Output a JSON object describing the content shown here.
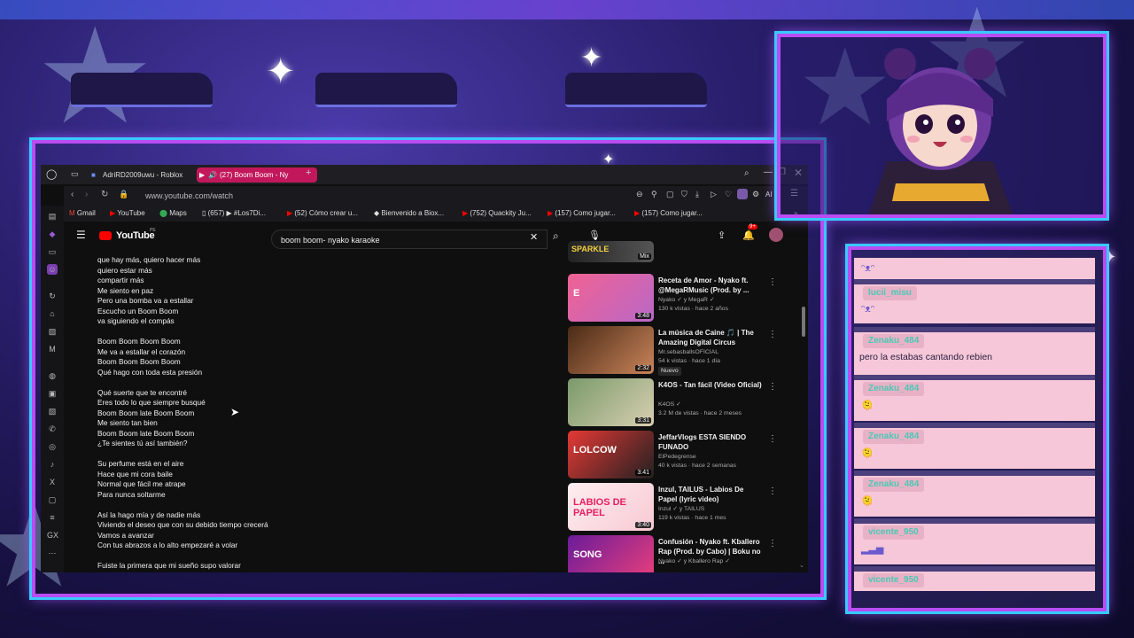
{
  "browser": {
    "tabs": [
      {
        "label": "AdriRD2009uwu - Roblox"
      },
      {
        "label": "(27) Boom Boom - Ny"
      }
    ],
    "new_tab": "+",
    "url": "www.youtube.com/watch",
    "ai_label": "AI",
    "bookmarks": [
      {
        "label": "Gmail"
      },
      {
        "label": "YouTube"
      },
      {
        "label": "Maps"
      },
      {
        "label": "(657) ▶ #Los7Di..."
      },
      {
        "label": "(52) Cómo crear u..."
      },
      {
        "label": "Bienvenido a Biox..."
      },
      {
        "label": "(752) Quackity Ju..."
      },
      {
        "label": "(157) Como jugar..."
      },
      {
        "label": "(157) Como jugar..."
      }
    ]
  },
  "youtube": {
    "logo": "YouTube",
    "logo_region": "PE",
    "search_value": "boom boom- nyako karaoke",
    "notif_count": "9+",
    "lyrics": [
      [
        "que hay más, quiero hacer más",
        "quiero estar más",
        "compartir más",
        "Me siento en paz",
        "Pero una bomba va a estallar",
        "Escucho un Boom Boom",
        "va siguiendo el compás"
      ],
      [
        "Boom Boom Boom Boom",
        "Me va a estallar el corazón",
        "Boom Boom Boom Boom",
        "Qué hago con toda esta presión"
      ],
      [
        "Qué suerte que te encontré",
        "Eres todo lo que siempre busqué",
        "Boom Boom late Boom Boom",
        "Me siento tan bien",
        "Boom Boom late Boom Boom",
        "¿Te sientes tú así también?"
      ],
      [
        "Su perfume está en el aire",
        "Hace que mi cora baile",
        "Normal que fácil me atrape",
        "Para nunca soltarme"
      ],
      [
        "Así la hago mía y de nadie más",
        "Viviendo el deseo que con su debido tiempo crecerá",
        "Vamos a avanzar",
        "Con tus abrazos a lo alto empezaré a volar"
      ],
      [
        "Fuiste la primera que mi sueño supo valorar"
      ]
    ],
    "partial_video": {
      "thumb_text": "SPARKLE",
      "badge": "Mix"
    },
    "related": [
      {
        "title": "Receta de Amor - Nyako ft. @MegaRMusic (Prod. by ...",
        "channel": "Nyako ✓ y MegaR ✓",
        "stats": "130 k vistas · hace 2 años",
        "duration": "3:48",
        "thumb_text": "E"
      },
      {
        "title": "La música de Caine 🎵 | The Amazing Digital Circus",
        "channel": "Mr.sebasballsOFICIAL",
        "stats": "54 k vistas · hace 1 día",
        "badge": "Nuevo",
        "duration": "2:32",
        "thumb_text": ""
      },
      {
        "title": "K4OS - Tan fácil (Video Oficial)",
        "channel": "K4OS ✓",
        "stats": "3.2 M de vistas · hace 2 meses",
        "duration": "3:31",
        "thumb_text": ""
      },
      {
        "title": "JeffarVlogs ESTA SIENDO FUNADO",
        "channel": "ElPedegrense",
        "stats": "40 k vistas · hace 2 semanas",
        "duration": "3:41",
        "thumb_text": "LOLCOW"
      },
      {
        "title": "Inzul, TAILUS - Labios De Papel (lyric video)",
        "channel": "Inzul ✓ y TAILUS",
        "stats": "119 k vistas · hace 1 mes",
        "duration": "3:40",
        "thumb_text": "LABIOS DE PAPEL"
      },
      {
        "title": "Confusión - Nyako ft. Kballero Rap (Prod. by Cabo) | Boku no ...",
        "channel": "Nyako ✓ y Kballero Rap ✓",
        "stats": "",
        "duration": "",
        "thumb_text": "SONG"
      }
    ]
  },
  "chat": {
    "messages": [
      {
        "user": "",
        "text": "ᵔᴥᵔ",
        "kind": "emote"
      },
      {
        "user": "lucii_misu",
        "text": "ᵔᴥᵔ",
        "kind": "emote"
      },
      {
        "user": "Zenaku_484",
        "text": "pero la estabas cantando rebien",
        "kind": "text"
      },
      {
        "user": "Zenaku_484",
        "text": "🫠",
        "kind": "emote"
      },
      {
        "user": "Zenaku_484",
        "text": "🫠",
        "kind": "emote"
      },
      {
        "user": "Zenaku_484",
        "text": "🫠",
        "kind": "emote"
      },
      {
        "user": "vicente_950",
        "text": "▂▃▅",
        "kind": "emote"
      },
      {
        "user": "vicente_950",
        "text": "",
        "kind": "emote"
      }
    ]
  }
}
